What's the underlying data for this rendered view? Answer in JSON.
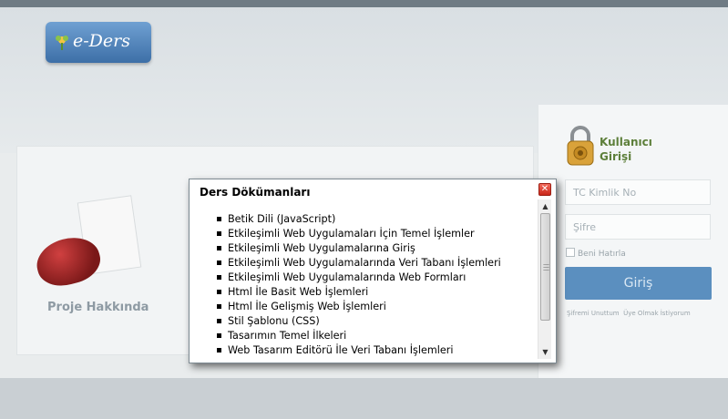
{
  "logo": {
    "text": "e-Ders",
    "icon": "flower-icon"
  },
  "panel": {
    "label": "Proje Hakkında"
  },
  "login": {
    "title_line1": "Kullanıcı",
    "title_line2": "Girişi",
    "tc_placeholder": "TC Kimlik No",
    "password_placeholder": "Şifre",
    "remember": "Beni Hatırla",
    "button": "Giriş",
    "forgot": "Şifremi Unuttum",
    "register": "Üye Olmak İstiyorum"
  },
  "dialog": {
    "title": "Ders Dökümanları",
    "close": "✕",
    "items": [
      "Betik Dili (JavaScript)",
      "Etkileşimli Web Uygulamaları İçin Temel İşlemler",
      "Etkileşimli Web Uygulamalarına Giriş",
      "Etkileşimli Web Uygulamalarında Veri Tabanı İşlemleri",
      "Etkileşimli Web Uygulamalarında Web Formları",
      "Html İle Basit Web İşlemleri",
      "Html İle Gelişmiş Web İşlemleri",
      "Stil Şablonu (CSS)",
      "Tasarımın Temel İlkeleri",
      "Web Tasarım Editörü İle Veri Tabanı İşlemleri"
    ]
  },
  "colors": {
    "accent": "#5b8fbf",
    "login_title": "#5d7f3a",
    "close_red": "#d63a2b"
  }
}
